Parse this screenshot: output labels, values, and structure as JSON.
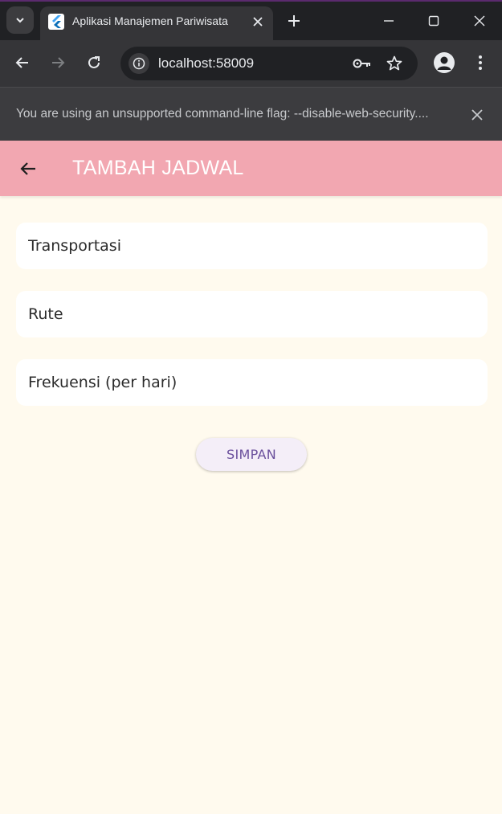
{
  "browser": {
    "tab_title": "Aplikasi Manajemen Pariwisata",
    "url": "localhost:58009",
    "infobar_message": "You are using an unsupported command-line flag: --disable-web-security....",
    "theme_accent": "#5b2a6e"
  },
  "app": {
    "title": "TAMBAH JADWAL",
    "appbar_color": "#f2a7b1",
    "background_color": "#fffaee",
    "fields": [
      {
        "placeholder": "Transportasi",
        "value": ""
      },
      {
        "placeholder": "Rute",
        "value": ""
      },
      {
        "placeholder": "Frekuensi (per hari)",
        "value": ""
      }
    ],
    "save_label": "SIMPAN",
    "button_text_color": "#6a4f9c"
  },
  "icons": {
    "tab_search": "chevron-down-icon",
    "favicon": "flutter-icon",
    "tab_close": "close-icon",
    "new_tab": "plus-icon",
    "minimize": "minimize-icon",
    "maximize": "maximize-icon",
    "window_close": "close-icon",
    "back": "arrow-left-icon",
    "forward": "arrow-right-icon",
    "reload": "reload-icon",
    "site_info": "info-icon",
    "password": "key-icon",
    "bookmark": "star-icon",
    "profile": "person-icon",
    "menu": "more-vertical-icon",
    "infobar_close": "close-icon",
    "app_back": "arrow-left-icon"
  }
}
